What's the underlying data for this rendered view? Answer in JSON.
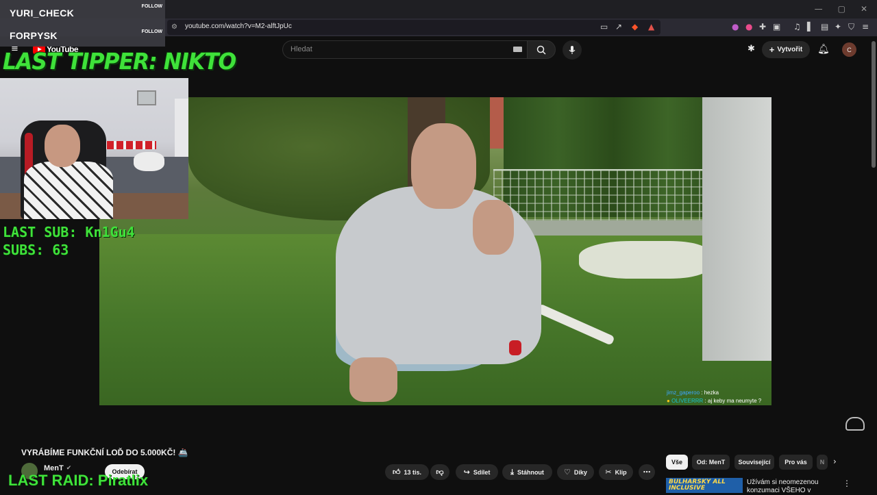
{
  "browser": {
    "url": "youtube.com/watch?v=M2-alftJpUc",
    "window_controls": [
      "—",
      "▢",
      "✕"
    ]
  },
  "youtube": {
    "logo_text": "YouTube",
    "search_placeholder": "Hledat",
    "create_label": "Vytvořit",
    "avatar_letter": "C"
  },
  "stream_overlay": {
    "follows": [
      {
        "name": "YURI_CHECK",
        "label": "FOLLOW"
      },
      {
        "name": "FORPYSK",
        "label": "FOLLOW"
      }
    ],
    "last_tipper": "LAST TIPPER: NIKTO",
    "last_sub": "LAST SUB: Kn1Gu4",
    "subs": "SUBS: 63",
    "last_raid": "LAST RAID: Piratlix",
    "chat": [
      {
        "user": "jimz_gaperoo",
        "message": ": hezka"
      },
      {
        "user": "OLIVEERRR",
        "message": ": aj keby ma neumyte ?"
      }
    ]
  },
  "video": {
    "title": "VYRÁBÍME FUNKČNÍ LOĎ DO 5.000KČ! 🚢",
    "channel": "MenT",
    "subscribe_label": "Odebírat",
    "actions": {
      "likes": "13 tis.",
      "share": "Sdílet",
      "download": "Stáhnout",
      "thanks": "Díky",
      "clip": "Klip"
    }
  },
  "sidebar": {
    "chips": [
      "Vše",
      "Od: MenT",
      "Související",
      "Pro vás",
      "N"
    ],
    "active_chip": "Vše",
    "recommendation": {
      "thumb_text": "BULHARSKY ALL INCLUSIVE",
      "title": "Užívám si neomezenou konzumaci VŠEHO v"
    }
  }
}
